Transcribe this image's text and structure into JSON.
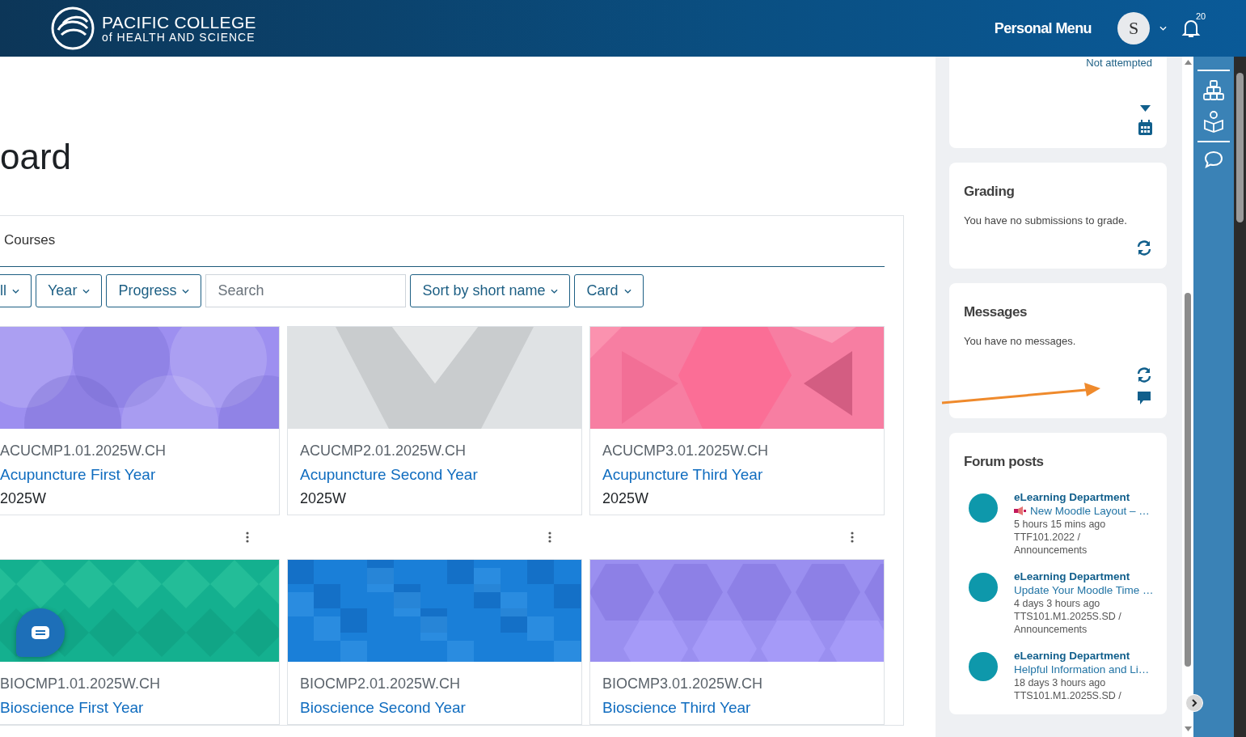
{
  "header": {
    "logo_title": "PACIFIC COLLEGE",
    "logo_subtitle": "of HEALTH AND SCIENCE",
    "personal_menu": "Personal Menu",
    "avatar_initial": "S",
    "notification_count": "20"
  },
  "page_title": "oard",
  "courses_panel": {
    "title": "Courses",
    "filters": [
      {
        "kind": "dropdown",
        "label": "ll"
      },
      {
        "kind": "dropdown",
        "label": "Year"
      },
      {
        "kind": "dropdown",
        "label": "Progress"
      },
      {
        "kind": "search",
        "placeholder": "Search"
      },
      {
        "kind": "dropdown",
        "label": "Sort by short name"
      },
      {
        "kind": "dropdown",
        "label": "Card"
      }
    ],
    "courses": [
      {
        "code": "ACUCMP1.01.2025W.CH",
        "name": "Acupuncture First Year",
        "term": "2025W",
        "kind": "picture"
      },
      {
        "code": "ACUCMP2.01.2025W.CH",
        "name": "Acupuncture Second Year",
        "term": "2025W",
        "kind": "picture"
      },
      {
        "code": "ACUCMP3.01.2025W.CH",
        "name": "Acupuncture Third Year",
        "term": "2025W",
        "kind": "picture"
      },
      {
        "code": "BIOCMP1.01.2025W.CH",
        "name": "Bioscience First Year",
        "kind": "picture"
      },
      {
        "code": "BIOCMP2.01.2025W.CH",
        "name": "Bioscience Second Year",
        "kind": "picture"
      },
      {
        "code": "BIOCMP3.01.2025W.CH",
        "name": "Bioscience Third Year",
        "kind": "picture"
      }
    ]
  },
  "blocks": [
    {
      "kind": "timeline",
      "status": "Not attempted"
    },
    {
      "kind": "grading",
      "title": "Grading",
      "text": "You have no submissions to grade."
    },
    {
      "kind": "messages",
      "title": "Messages",
      "text": "You have no messages."
    },
    {
      "kind": "forum",
      "title": "Forum posts",
      "posts": [
        {
          "author": "eLearning Department",
          "subject": "New Moodle Layout – …",
          "announcement_icon": true,
          "time": "5 hours 15 mins ago",
          "course": "TTF101.2022 /",
          "forum": "Announcements"
        },
        {
          "author": "eLearning Department",
          "subject": "Update Your Moodle Time …",
          "announcement_icon": false,
          "time": "4 days 3 hours ago",
          "course": "TTS101.M1.2025S.SD /",
          "forum": "Announcements"
        },
        {
          "author": "eLearning Department",
          "subject": "Helpful Information and Li…",
          "announcement_icon": false,
          "time": "18 days 3 hours ago",
          "course": "TTS101.M1.2025S.SD /"
        }
      ]
    }
  ]
}
